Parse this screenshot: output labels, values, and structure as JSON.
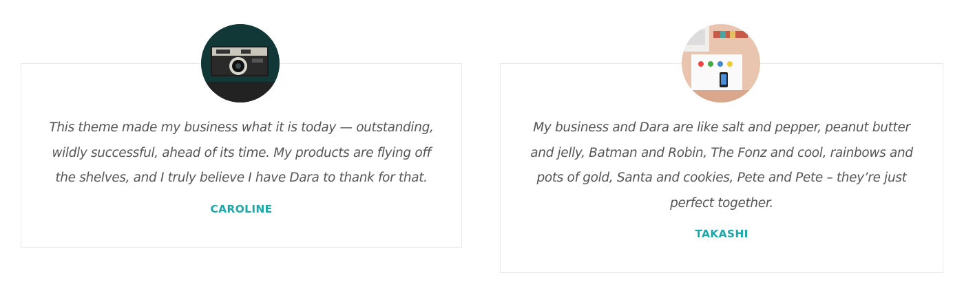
{
  "testimonials": [
    {
      "quote": "This theme made my business what it is today — outstanding, wildly successful, ahead of its time. My products are flying off the shelves, and I truly believe I have Dara to thank for that.",
      "name": "CAROLINE",
      "avatar_icon": "camera-photo-icon"
    },
    {
      "quote": "My business and Dara are like salt and pepper, peanut butter and jelly, Batman and Robin, The Fonz and cool, rainbows and pots of gold, Santa and cookies, Pete and Pete – they’re just perfect together.",
      "name": "TAKASHI",
      "avatar_icon": "desk-workspace-icon"
    }
  ],
  "colors": {
    "accent": "#1aa8a8",
    "quote_text": "#555555",
    "card_border": "#e8e8e8"
  }
}
